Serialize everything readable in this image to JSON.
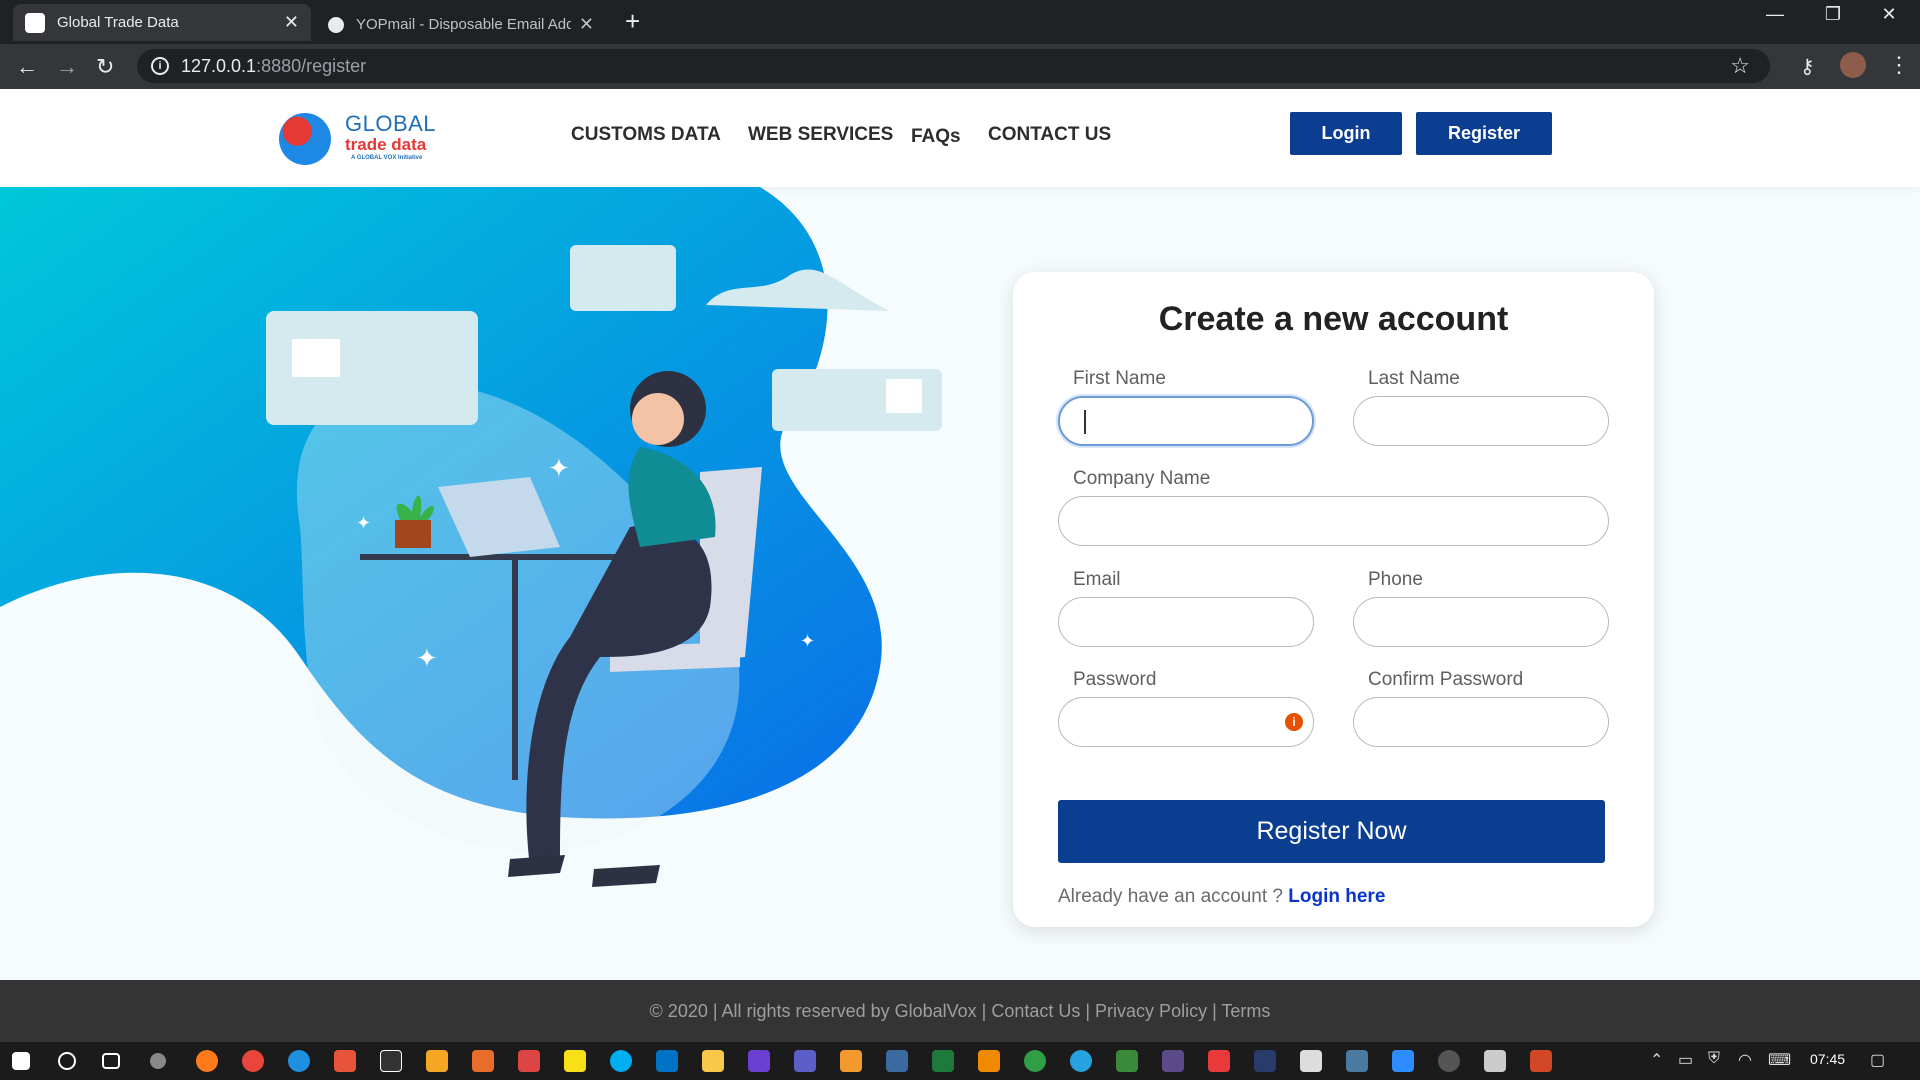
{
  "browser": {
    "tabs": [
      {
        "title": "Global Trade Data",
        "active": true
      },
      {
        "title": "YOPmail - Disposable Email Addr",
        "active": false
      }
    ],
    "url_host": "127.0.0.1",
    "url_path": ":8880/register"
  },
  "header": {
    "logo": {
      "line1": "GLOBAL",
      "line2": "trade data",
      "line3": "A GLOBAL VOX Initiative"
    },
    "nav": [
      "CUSTOMS DATA",
      "WEB SERVICES",
      "FAQs",
      "CONTACT US"
    ],
    "login_label": "Login",
    "register_label": "Register"
  },
  "form": {
    "title": "Create a new account",
    "fields": {
      "first_name": "First Name",
      "last_name": "Last Name",
      "company_name": "Company Name",
      "email": "Email",
      "phone": "Phone",
      "password": "Password",
      "confirm_password": "Confirm Password"
    },
    "submit_label": "Register Now",
    "already_text": "Already have an account ?",
    "login_link": "Login here"
  },
  "footer": {
    "text": "© 2020 | All rights reserved by GlobalVox | Contact Us | Privacy Policy | Terms"
  },
  "taskbar": {
    "time": "07:45"
  },
  "colors": {
    "brand_blue": "#0b3d91",
    "illustration_cyan": "#00c3dd",
    "footer_bg": "#343434"
  }
}
